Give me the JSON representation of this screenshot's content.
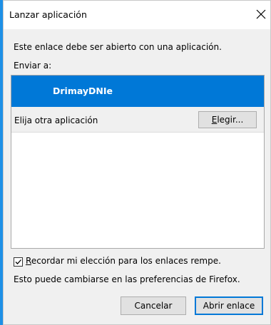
{
  "window": {
    "title": "Lanzar aplicación"
  },
  "dialog": {
    "message": "Este enlace debe ser abierto con una aplicación.",
    "send_to_label": "Enviar a:",
    "apps": {
      "selected": "DrimayDNIe",
      "other_label": "Elija otra aplicación",
      "choose_button_prefix": "E",
      "choose_button_rest": "legir..."
    },
    "remember": {
      "checked": true,
      "label_prefix": "R",
      "label_rest": "ecordar mi elección para los enlaces rempe."
    },
    "note": "Esto puede cambiarse en las preferencias de Firefox.",
    "buttons": {
      "cancel": "Cancelar",
      "open": "Abrir enlace"
    }
  },
  "colors": {
    "desktop": "#1e90e6",
    "selection": "#0078d7",
    "dialog_bg": "#f0f0f0"
  }
}
